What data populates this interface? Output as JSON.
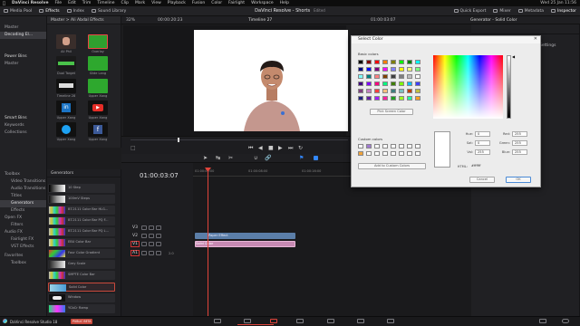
{
  "app_name": "DaVinci Resolve",
  "menu": [
    "File",
    "Edit",
    "Trim",
    "Timeline",
    "Clip",
    "Mark",
    "View",
    "Playback",
    "Fusion",
    "Color",
    "Fairlight",
    "Workspace",
    "Help"
  ],
  "menu_right": "Wed 25 Jan 11:56",
  "window_title": "DaVinci Resolve - Shorts",
  "window_subtitle": "Edited",
  "toolbar_left": [
    "Media Pool",
    "Effects",
    "Index",
    "Sound Library"
  ],
  "toolbar_right": [
    "Quick Export",
    "Mixer",
    "Metadata",
    "Inspector"
  ],
  "viewer_bar": {
    "zoom": "32%",
    "timecode_left": "00:00:20:23",
    "timeline_name": "Timeline 27",
    "timecode_right": "01:00:03:07"
  },
  "inspector_title": "Generator - Solid Color",
  "inspector_settings": "Settings",
  "media_pool": {
    "bins": [
      "Master",
      "Decoding El...",
      "Master"
    ],
    "power_bins": "Power Bins",
    "smart_bins": "Smart Bins",
    "smart_items": [
      "Keywords",
      "Collections"
    ],
    "breadcrumb": "Master  >  Ali Abdal Effects",
    "clips": [
      "Ali Phil",
      "Overlay",
      "Dual Target",
      "Slide Lang",
      "Timeline 28",
      "Upper Xang",
      "Upper Xang",
      "Upper Xang",
      "Upper Xang",
      "Upper Xang"
    ]
  },
  "effects": {
    "tree": [
      "Toolbox",
      "Video Transitions",
      "Audio Transitions",
      "Titles",
      "Generators",
      "Effects",
      "Open FX",
      "Filters",
      "Audio FX",
      "Fairlight FX",
      "VST Effects",
      "Favorites",
      "Toolbox"
    ],
    "generators_header": "Generators",
    "generators": [
      "10 Step",
      "100mV Steps",
      "BT.2111 Color Bar HLG...",
      "BT.2111 Color Bar PQ F...",
      "BT.2111 Color Bar PQ L...",
      "EBU Color Bar",
      "Four Color Gradient",
      "Grey Scale",
      "SMPTE Color Bar",
      "Solid Color",
      "Window",
      "YCbCr Ramp"
    ]
  },
  "timeline": {
    "timecode": "01:00:03:07",
    "ruler": [
      "01:00:00:00",
      "01:00:08:00",
      "01:00:16:00"
    ],
    "tracks": [
      "V3",
      "V2",
      "V1",
      "A1"
    ],
    "a1_value": "2.0",
    "clip_v2": "Paper Effect",
    "clip_v1": "Solid Color"
  },
  "dialog": {
    "title": "Select Color",
    "basic_colors": "Basic colors",
    "pick_screen": "Pick Screen Color",
    "custom_colors": "Custom colors",
    "add_custom": "Add to Custom Colors",
    "hue_label": "Hue:",
    "hue": "0",
    "sat_label": "Sat:",
    "sat": "0",
    "val_label": "Val:",
    "val": "255",
    "red_label": "Red:",
    "red": "255",
    "green_label": "Green:",
    "green": "255",
    "blue_label": "Blue:",
    "blue": "255",
    "html_label": "HTML:",
    "html": "#ffffff",
    "cancel": "Cancel",
    "ok": "OK"
  },
  "status_bar": {
    "app": "DaVinci Resolve Studio 18",
    "badge": "PUBLIC BETA"
  },
  "colors": {
    "accent": "#c9493c",
    "playhead": "#e0443b",
    "clip_v2": "#5b7ea8",
    "clip_v1": "#c78ab3",
    "pick_button": "#f0a33a"
  }
}
